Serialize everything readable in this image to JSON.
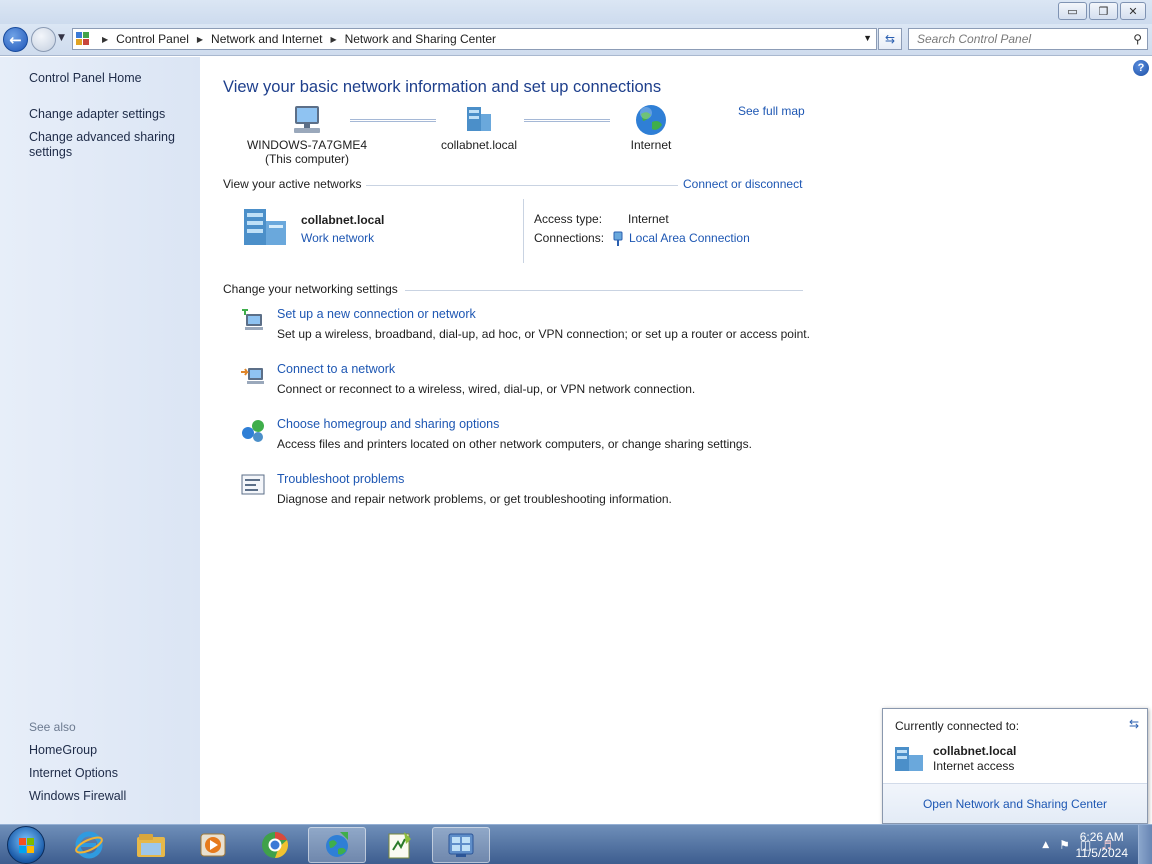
{
  "window": {
    "minimize_glyph": "▭",
    "restore_glyph": "❐",
    "close_glyph": "✕"
  },
  "address": {
    "crumbs": [
      "Control Panel",
      "Network and Internet",
      "Network and Sharing Center"
    ],
    "search_placeholder": "Search Control Panel"
  },
  "left": {
    "home": "Control Panel Home",
    "links": [
      "Change adapter settings",
      "Change advanced sharing settings"
    ],
    "see_also_label": "See also",
    "see_also": [
      "HomeGroup",
      "Internet Options",
      "Windows Firewall"
    ]
  },
  "main": {
    "heading": "View your basic network information and set up connections",
    "see_full_map": "See full map",
    "map": {
      "computer_name": "WINDOWS-7A7GME4",
      "computer_sub": "(This computer)",
      "network": "collabnet.local",
      "internet": "Internet"
    },
    "active_label": "View your active networks",
    "connect_disconnect": "Connect or disconnect",
    "active": {
      "name": "collabnet.local",
      "type": "Work network",
      "access_type_label": "Access type:",
      "access_type_value": "Internet",
      "connections_label": "Connections:",
      "connections_value": "Local Area Connection"
    },
    "change_label": "Change your networking settings",
    "tasks": [
      {
        "title": "Set up a new connection or network",
        "desc": "Set up a wireless, broadband, dial-up, ad hoc, or VPN connection; or set up a router or access point."
      },
      {
        "title": "Connect to a network",
        "desc": "Connect or reconnect to a wireless, wired, dial-up, or VPN network connection."
      },
      {
        "title": "Choose homegroup and sharing options",
        "desc": "Access files and printers located on other network computers, or change sharing settings."
      },
      {
        "title": "Troubleshoot problems",
        "desc": "Diagnose and repair network problems, or get troubleshooting information."
      }
    ]
  },
  "popup": {
    "title": "Currently connected to:",
    "network": "collabnet.local",
    "access": "Internet access",
    "footer_link": "Open Network and Sharing Center"
  },
  "taskbar": {
    "time": "6:26 AM",
    "date": "11/5/2024"
  },
  "colors": {
    "link": "#1e57b3",
    "heading": "#1e3f8c",
    "left_pane": "#e7eef9"
  }
}
